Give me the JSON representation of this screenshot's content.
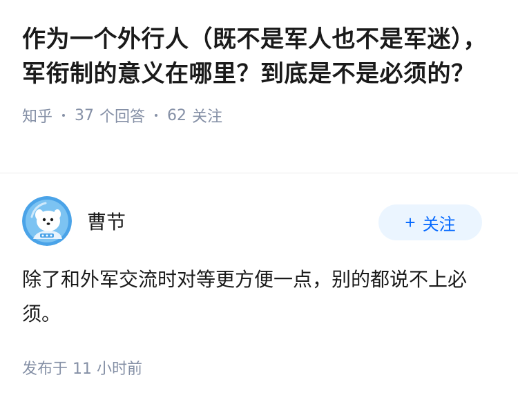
{
  "question": {
    "title": "作为一个外行人（既不是军人也不是军迷），军衔制的意义在哪里？到底是不是必须的？",
    "source": "知乎",
    "answer_count": "37",
    "answer_label": "个回答",
    "follower_count": "62",
    "follower_label": "关注"
  },
  "answer": {
    "author_name": "曹节",
    "avatar_icon": "dog-mascot-avatar-icon",
    "follow_button": {
      "plus": "+",
      "label": "关注"
    },
    "content": "除了和外军交流时对等更方便一点，别的都说不上必须。",
    "publish_time": "发布于 11 小时前"
  },
  "colors": {
    "title": "#1a1a1a",
    "meta": "#8590a6",
    "follow_bg": "#ebf5ff",
    "follow_text": "#0066ff",
    "divider": "#ebebeb"
  }
}
